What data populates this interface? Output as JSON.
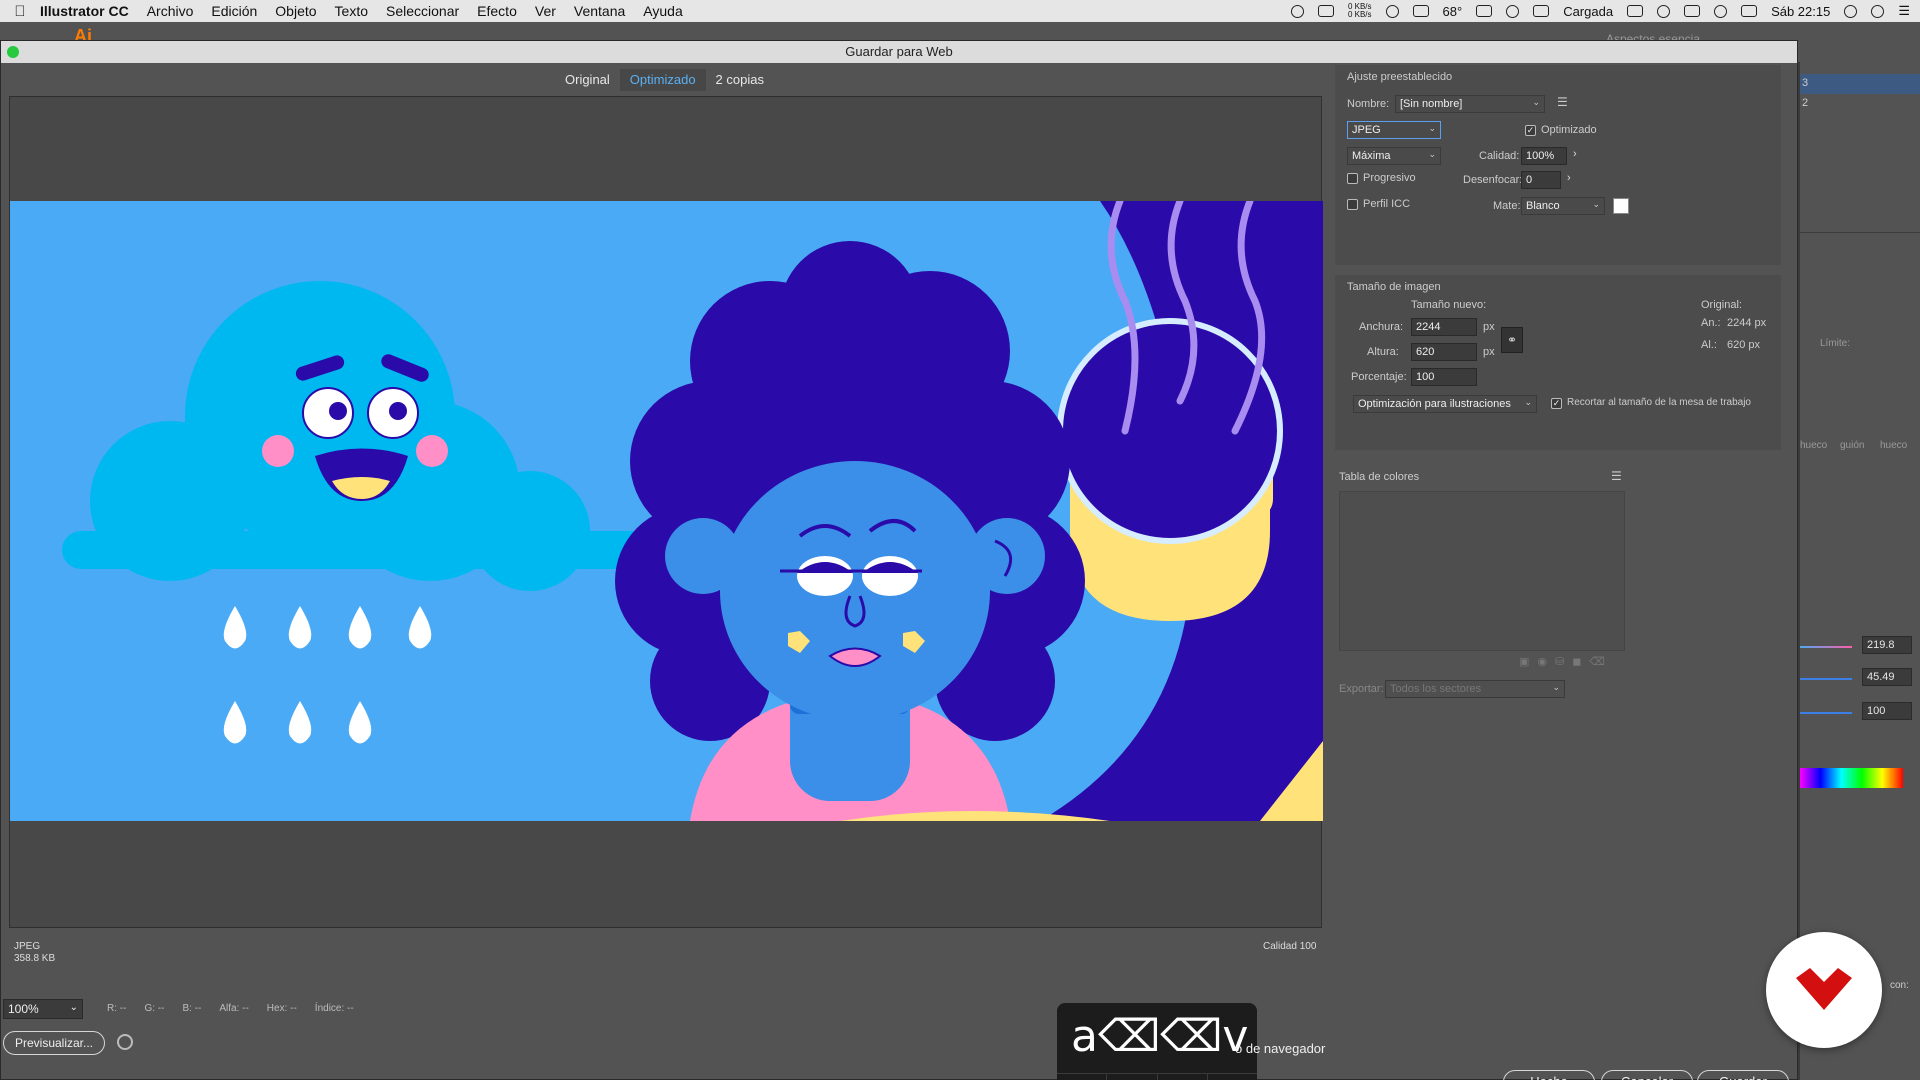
{
  "menubar": {
    "app_name": "Illustrator CC",
    "items": [
      "Archivo",
      "Edición",
      "Objeto",
      "Texto",
      "Seleccionar",
      "Efecto",
      "Ver",
      "Ventana",
      "Ayuda"
    ],
    "net_up": "0 KB/s",
    "net_down": "0 KB/s",
    "temp": "68°",
    "battery_label": "Cargada",
    "clock": "Sáb 22:15"
  },
  "app": {
    "workspace": "Aspectos esencia",
    "layers": [
      "3",
      "2"
    ],
    "limit_label": "Límite:",
    "stroke_labels": [
      "hueco",
      "guión",
      "hueco"
    ],
    "color_values": [
      "219.8",
      "45.49",
      "100"
    ],
    "con_label": "con:"
  },
  "dialog": {
    "title": "Guardar para Web",
    "tabs": [
      "Original",
      "Optimizado",
      "2 copias"
    ],
    "active_tab": "Optimizado",
    "info_format": "JPEG",
    "info_size": "358.8 KB",
    "info_quality": "Calidad 100",
    "zoom": "100%",
    "readouts": {
      "r": "R: --",
      "g": "G: --",
      "b": "B: --",
      "alpha": "Alfa: --",
      "hex": "Hex: --",
      "index": "Índice: --"
    },
    "preview_button": "Previsualizar...",
    "browser_text": "o de navegador",
    "keystrokes": "a⌫⌫v",
    "modifiers": [
      "⇧",
      "^",
      "⌥",
      "⌘"
    ],
    "buttons": {
      "done": "Hecho",
      "cancel": "Cancelar",
      "save": "Guardar"
    }
  },
  "preset": {
    "section_title": "Ajuste preestablecido",
    "name_label": "Nombre:",
    "name_value": "[Sin nombre]",
    "format": "JPEG",
    "optimized_label": "Optimizado",
    "optimized_checked": true,
    "quality_preset": "Máxima",
    "quality_label": "Calidad:",
    "quality_value": "100%",
    "progressive_label": "Progresivo",
    "progressive_checked": false,
    "blur_label": "Desenfocar:",
    "blur_value": "0",
    "icc_label": "Perfil ICC",
    "icc_checked": false,
    "matte_label": "Mate:",
    "matte_value": "Blanco",
    "matte_color": "#ffffff"
  },
  "image_size": {
    "section_title": "Tamaño de imagen",
    "new_size_label": "Tamaño nuevo:",
    "width_label": "Anchura:",
    "width_value": "2244",
    "height_label": "Altura:",
    "height_value": "620",
    "unit": "px",
    "percent_label": "Porcentaje:",
    "percent_value": "100",
    "original_label": "Original:",
    "orig_width_label": "An.:",
    "orig_width_value": "2244 px",
    "orig_height_label": "Al.:",
    "orig_height_value": "620 px",
    "optimization": "Optimización para ilustraciones",
    "crop_label": "Recortar al tamaño de la mesa de trabajo",
    "crop_checked": true
  },
  "color_table": {
    "title": "Tabla de colores"
  },
  "export": {
    "label": "Exportar:",
    "value": "Todos los sectores"
  },
  "colors": {
    "sky": "#4aaaf5",
    "cloud": "#00b8f0",
    "dark_blue": "#2a0aa8",
    "face_blue": "#3b8fe8",
    "yellow": "#ffe27a",
    "pink": "#ff8fc6",
    "logo_red": "#d40f0f"
  }
}
